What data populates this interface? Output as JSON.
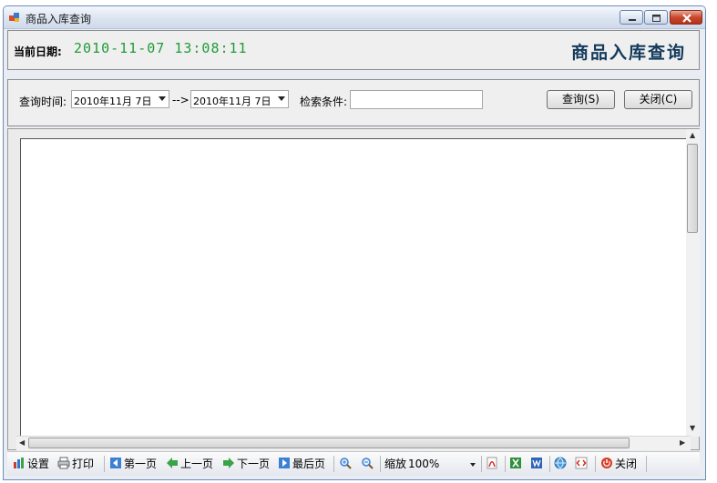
{
  "window": {
    "title": "商品入库查询"
  },
  "header": {
    "date_label": "当前日期:",
    "date_value": "2010-11-07 13:08:11",
    "page_title": "商品入库查询"
  },
  "filter": {
    "time_label": "查询时间:",
    "start_date": "2010年11月 7日",
    "arrow_text": "-->",
    "end_date": "2010年11月 7日",
    "condition_label": "检索条件:",
    "condition_value": "",
    "query_button": "查询(S)",
    "close_button": "关闭(C)"
  },
  "toolbar": {
    "settings": "设置",
    "print": "打印",
    "first_page": "第一页",
    "prev_page": "上一页",
    "next_page": "下一页",
    "last_page": "最后页",
    "zoom_label": "缩放",
    "zoom_value": "100%",
    "close": "关闭"
  },
  "icons": {
    "app": "app-icon",
    "minimize": "minimize-icon",
    "maximize": "maximize-icon",
    "close": "close-icon",
    "settings": "settings-icon",
    "print": "printer-icon",
    "first": "first-page-icon",
    "prev": "left-arrow-icon",
    "next": "right-arrow-icon",
    "last": "last-page-icon",
    "zoom_in": "zoom-in-icon",
    "zoom_out": "zoom-out-icon",
    "pdf": "pdf-icon",
    "excel": "excel-icon",
    "word": "word-icon",
    "web": "globe-icon",
    "html": "html-icon",
    "toolbar_close": "power-icon"
  },
  "colors": {
    "date_digits": "#1f9c36",
    "heading": "#133a5c",
    "close_button": "#c9482c"
  }
}
